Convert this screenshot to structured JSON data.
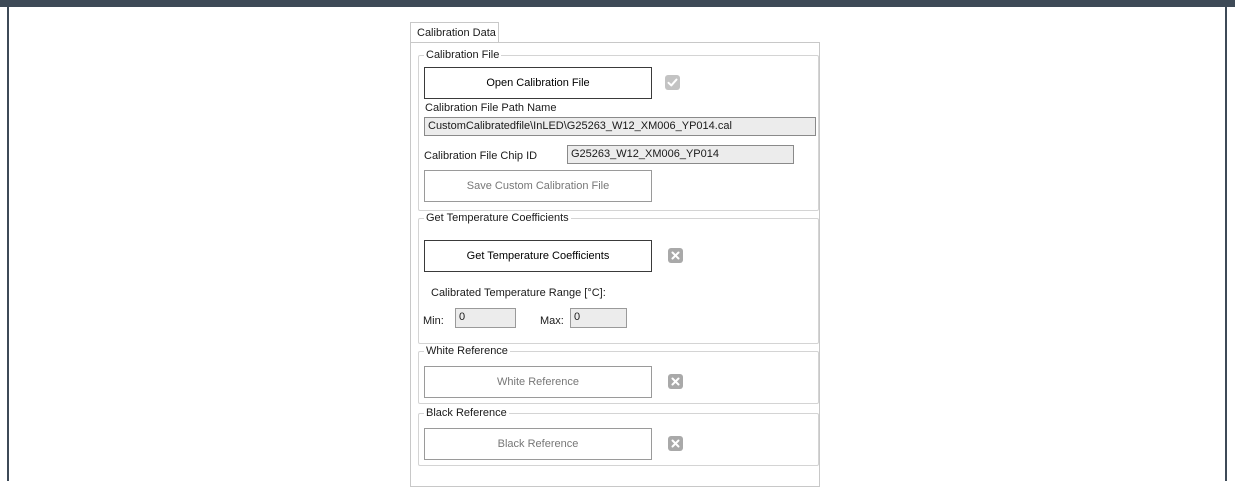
{
  "tab": {
    "label": "Calibration Data"
  },
  "calibration_file": {
    "legend": "Calibration File",
    "open_button": "Open Calibration File",
    "path_label": "Calibration File Path Name",
    "path_value": "CustomCalibratedfile\\InLED\\G25263_W12_XM006_YP014.cal",
    "chip_id_label": "Calibration File Chip ID",
    "chip_id_value": "G25263_W12_XM006_YP014",
    "save_button": "Save Custom Calibration File",
    "status": "success"
  },
  "temperature": {
    "legend": "Get Temperature Coefficients",
    "get_button": "Get Temperature Coefficients",
    "range_label": "Calibrated Temperature Range [°C]:",
    "min_label": "Min:",
    "min_value": "0",
    "max_label": "Max:",
    "max_value": "0",
    "status": "not-done"
  },
  "white_reference": {
    "legend": "White Reference",
    "button": "White Reference",
    "status": "not-done"
  },
  "black_reference": {
    "legend": "Black Reference",
    "button": "Black Reference",
    "status": "not-done"
  },
  "colors": {
    "frame": "#3e4a57",
    "group_border": "#d4d4d4",
    "status_icon": "#a9a9a9"
  },
  "icons": {
    "success": "check-icon",
    "not_done": "x-icon"
  }
}
